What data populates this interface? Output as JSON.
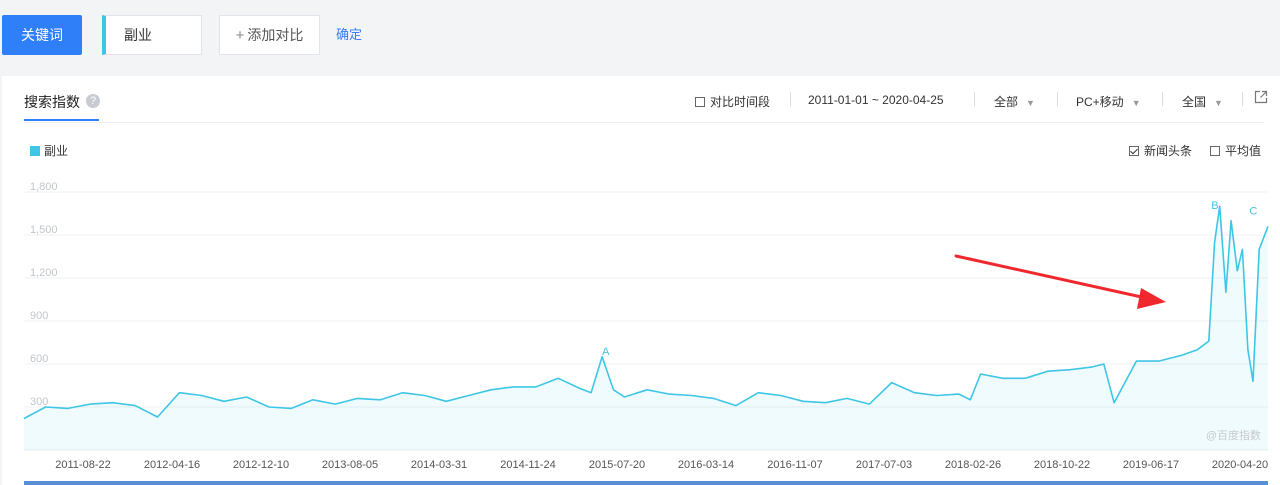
{
  "toolbar": {
    "keyword_button": "关键词",
    "keyword_value": "副业",
    "add_compare": "添加对比",
    "confirm": "确定"
  },
  "panel": {
    "title": "搜索指数",
    "help_icon": "?",
    "compare_period": "对比时间段",
    "date_range": "2011-01-01 ~ 2020-04-25",
    "scope": "全部",
    "device": "PC+移动",
    "region": "全国",
    "legend_label": "副业",
    "news_label": "新闻头条",
    "avg_label": "平均值",
    "watermark": "@百度指数"
  },
  "colors": {
    "accent": "#2f7ff8",
    "series": "#3ec6e6",
    "arrow": "#f0282d"
  },
  "chart_data": {
    "type": "area",
    "ylim": [
      0,
      1800
    ],
    "y_ticks": [
      "1,800",
      "1,500",
      "1,200",
      "900",
      "600",
      "300"
    ],
    "x_labels": [
      "2011-08-22",
      "2012-04-16",
      "2012-12-10",
      "2013-08-05",
      "2014-03-31",
      "2014-11-24",
      "2015-07-20",
      "2016-03-14",
      "2016-11-07",
      "2017-07-03",
      "2018-02-26",
      "2018-10-22",
      "2019-06-17",
      "2020-04-20"
    ],
    "x_range": [
      "2011-01-01",
      "2020-04-25"
    ],
    "grid": true,
    "annotations": [
      {
        "label": "A",
        "date": "2015-05-11",
        "value": 620
      },
      {
        "label": "B",
        "date": "2019-12-02",
        "value": 1640
      },
      {
        "label": "C",
        "date": "2020-03-16",
        "value": 1600
      }
    ],
    "series": [
      {
        "name": "副业",
        "x": [
          "2011-01-01",
          "2011-03-01",
          "2011-05-01",
          "2011-07-01",
          "2011-09-01",
          "2011-11-01",
          "2012-01-01",
          "2012-03-01",
          "2012-05-01",
          "2012-07-01",
          "2012-09-01",
          "2012-11-01",
          "2013-01-01",
          "2013-03-01",
          "2013-05-01",
          "2013-07-01",
          "2013-09-01",
          "2013-11-01",
          "2014-01-01",
          "2014-03-01",
          "2014-05-01",
          "2014-07-01",
          "2014-09-01",
          "2014-11-01",
          "2015-01-01",
          "2015-03-01",
          "2015-04-01",
          "2015-05-01",
          "2015-06-01",
          "2015-07-01",
          "2015-09-01",
          "2015-11-01",
          "2016-01-01",
          "2016-03-01",
          "2016-05-01",
          "2016-07-01",
          "2016-09-01",
          "2016-11-01",
          "2017-01-01",
          "2017-03-01",
          "2017-05-01",
          "2017-07-01",
          "2017-09-01",
          "2017-11-01",
          "2018-01-01",
          "2018-02-01",
          "2018-03-01",
          "2018-05-01",
          "2018-07-01",
          "2018-09-01",
          "2018-11-01",
          "2019-01-01",
          "2019-02-01",
          "2019-03-01",
          "2019-05-01",
          "2019-07-01",
          "2019-09-01",
          "2019-10-15",
          "2019-11-15",
          "2019-12-01",
          "2019-12-15",
          "2020-01-01",
          "2020-01-15",
          "2020-02-01",
          "2020-02-15",
          "2020-03-01",
          "2020-03-15",
          "2020-04-01",
          "2020-04-25"
        ],
        "values": [
          220,
          300,
          290,
          320,
          330,
          310,
          230,
          400,
          380,
          340,
          370,
          300,
          290,
          350,
          320,
          360,
          350,
          400,
          380,
          340,
          380,
          420,
          440,
          440,
          500,
          430,
          400,
          650,
          420,
          370,
          420,
          390,
          380,
          360,
          310,
          400,
          380,
          340,
          330,
          360,
          320,
          470,
          400,
          380,
          390,
          350,
          530,
          500,
          500,
          550,
          560,
          580,
          600,
          330,
          620,
          620,
          660,
          700,
          760,
          1450,
          1700,
          1100,
          1600,
          1250,
          1400,
          700,
          480,
          1400,
          1560
        ]
      }
    ]
  }
}
